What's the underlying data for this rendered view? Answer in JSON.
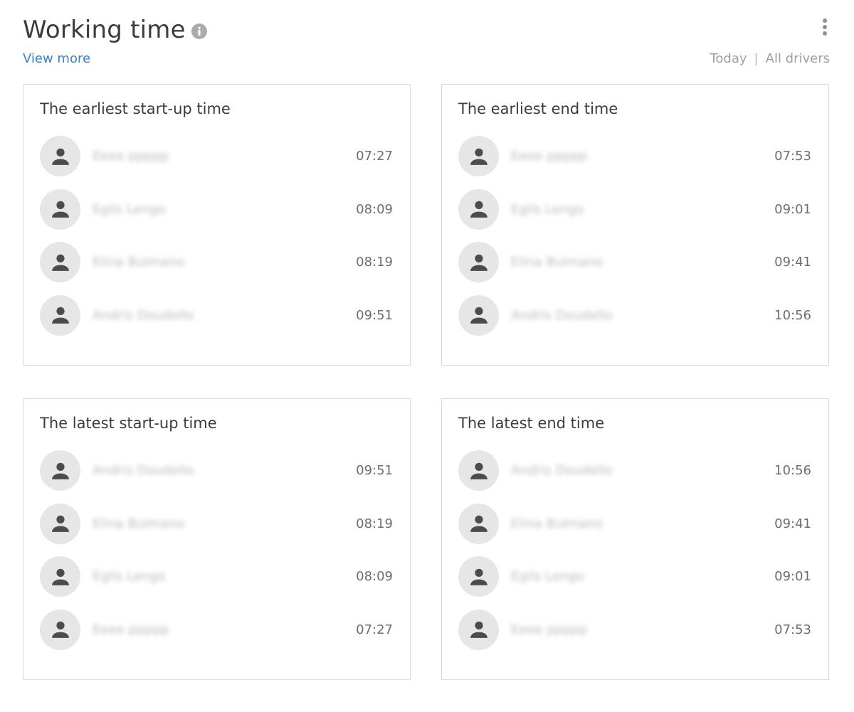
{
  "header": {
    "title": "Working time",
    "view_more": "View more",
    "filter_period": "Today",
    "filter_separator": "|",
    "filter_drivers": "All drivers"
  },
  "icons": {
    "info": "info-icon",
    "menu": "more-vertical-icon",
    "avatar": "person-icon"
  },
  "colors": {
    "link": "#3a82c4",
    "avatar_bg": "#e6e6e7",
    "avatar_icon": "#4a4c50",
    "border": "#d9dadc"
  },
  "cards": [
    {
      "title": "The earliest start-up time",
      "rows": [
        {
          "name": "Eeee ppppp",
          "time": "07:27"
        },
        {
          "name": "Egils Lengo",
          "time": "08:09"
        },
        {
          "name": "Elina Bulmano",
          "time": "08:19"
        },
        {
          "name": "Andris Doudello",
          "time": "09:51"
        }
      ]
    },
    {
      "title": "The earliest end time",
      "rows": [
        {
          "name": "Eeee ppppp",
          "time": "07:53"
        },
        {
          "name": "Egils Lengo",
          "time": "09:01"
        },
        {
          "name": "Elina Bulmano",
          "time": "09:41"
        },
        {
          "name": "Andris Doudello",
          "time": "10:56"
        }
      ]
    },
    {
      "title": "The latest start-up time",
      "rows": [
        {
          "name": "Andris Doudello",
          "time": "09:51"
        },
        {
          "name": "Elina Bulmano",
          "time": "08:19"
        },
        {
          "name": "Egils Lengo",
          "time": "08:09"
        },
        {
          "name": "Eeee ppppp",
          "time": "07:27"
        }
      ]
    },
    {
      "title": "The latest end time",
      "rows": [
        {
          "name": "Andris Doudello",
          "time": "10:56"
        },
        {
          "name": "Elina Bulmano",
          "time": "09:41"
        },
        {
          "name": "Egils Lengo",
          "time": "09:01"
        },
        {
          "name": "Eeee ppppp",
          "time": "07:53"
        }
      ]
    }
  ]
}
